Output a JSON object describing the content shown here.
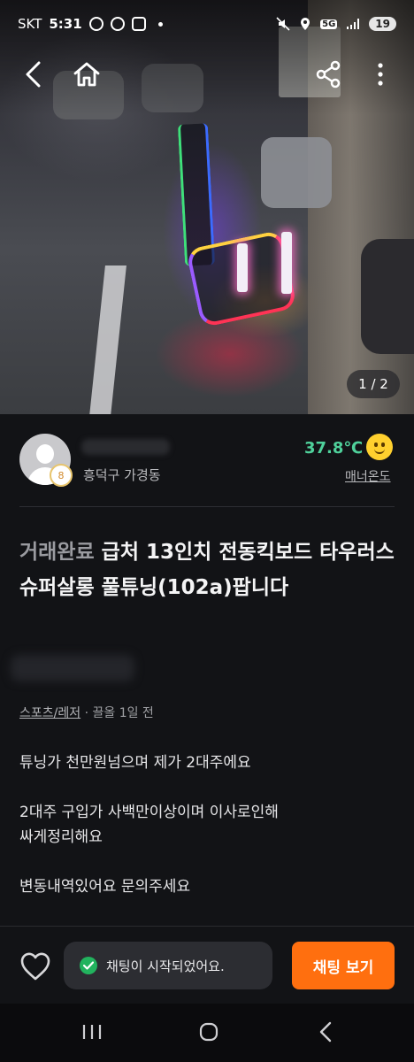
{
  "status_bar": {
    "carrier": "SKT",
    "time": "5:31",
    "network": "5G",
    "battery": "19"
  },
  "toolbar": {
    "back_icon": "chevron-left-icon",
    "home_icon": "home-icon",
    "share_icon": "share-icon",
    "more_icon": "more-vertical-icon"
  },
  "hero": {
    "image_counter": "1 / 2"
  },
  "seller": {
    "location": "흥덕구 가경동",
    "manner_temp": "37.8℃",
    "manner_label": "매너온도"
  },
  "listing": {
    "status_tag": "거래완료",
    "title": "급처 13인치 전동킥보드 타우러스 슈퍼살롱 풀튜닝(102a)팝니다",
    "category": "스포츠/레저",
    "bump_info": "· 끌올 1일 전",
    "description": [
      "튜닝가 천만원넘으며 제가 2대주에요",
      "2대주 구입가 사백만이상이며 이사로인해",
      "싸게정리해요",
      "변동내역있어요 문의주세요"
    ]
  },
  "bottom_bar": {
    "toast": "채팅이 시작되었어요.",
    "chat_button": "채팅 보기"
  },
  "colors": {
    "accent": "#ff6f0f",
    "manner_green": "#4fd19b",
    "success": "#22b35e",
    "background": "#121316"
  }
}
